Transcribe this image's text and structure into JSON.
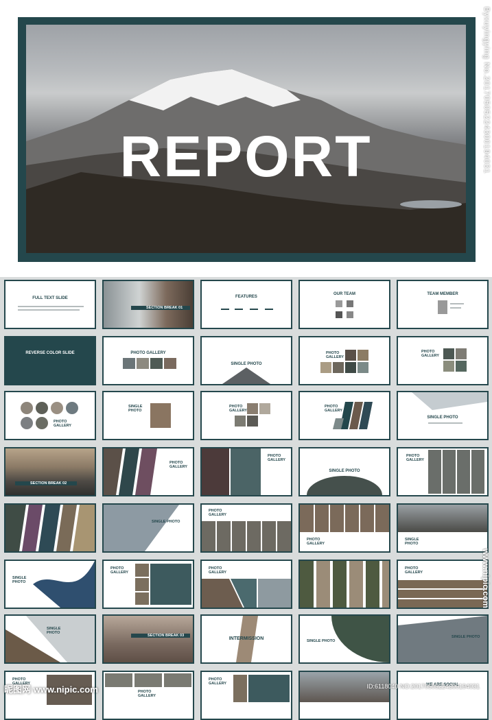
{
  "hero": {
    "title": "REPORT",
    "watermark": "Byxuyingying  No.20170505224300194031"
  },
  "slides": {
    "full_text": "FULL TEXT SLIDE",
    "section_break_01": "SECTION BREAK 01",
    "features": "FEATURES",
    "our_team": "OUR TEAM",
    "team_member": "TEAM MEMBER",
    "reverse_color": "REVERSE COLOR SLIDE",
    "photo_gallery": "PHOTO GALLERY",
    "single_photo": "SINGLE PHOTO",
    "photo_gallery_stacked": "PHOTO\nGALLERY",
    "single_stacked": "SINGLE\nPHOTO",
    "section_break_02": "SECTION BREAK 02",
    "section_break_03": "SECTION BREAK 03",
    "intermission": "INTERMISSION",
    "we_are_social": "WE ARE SOCIAL"
  },
  "bottom": {
    "logo": "昵图网 www.nipic.com",
    "id": "ID:6118040 NO:20170505224300194031",
    "side": "www.nipic.com"
  }
}
